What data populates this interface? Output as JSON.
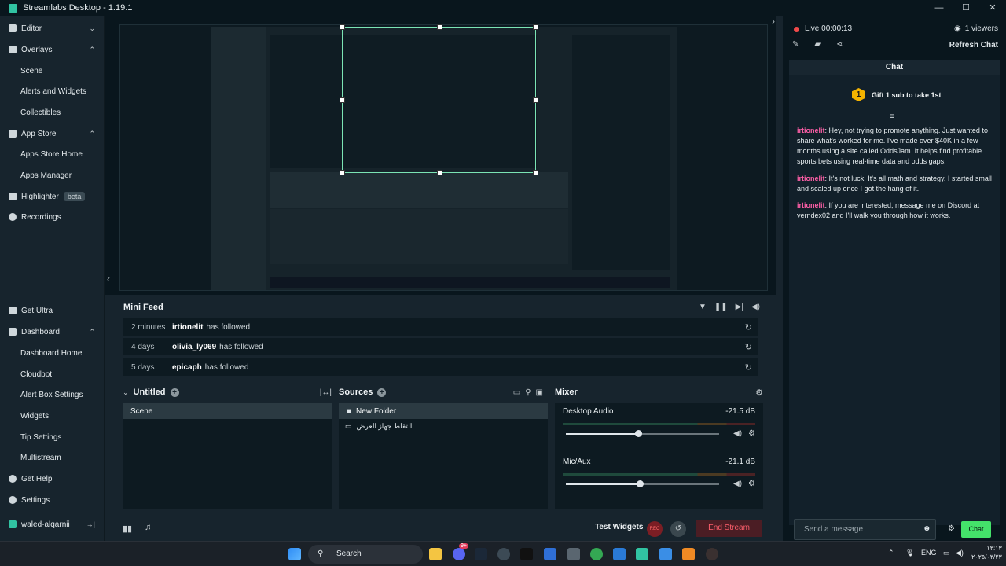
{
  "window": {
    "title": "Streamlabs Desktop - 1.19.1",
    "controls": [
      "—",
      "☐",
      "✕"
    ]
  },
  "sidebar": {
    "top_items": [
      {
        "label": "Editor",
        "icon": "editor-icon",
        "chevron": "⌄"
      },
      {
        "label": "Overlays",
        "icon": "overlays-icon",
        "chevron": "⌃"
      },
      {
        "label": "Scene",
        "sub": true
      },
      {
        "label": "Alerts and Widgets",
        "sub": true
      },
      {
        "label": "Collectibles",
        "sub": true
      },
      {
        "label": "App Store",
        "icon": "app-store-icon",
        "chevron": "⌃"
      },
      {
        "label": "Apps Store Home",
        "sub": true
      },
      {
        "label": "Apps Manager",
        "sub": true
      },
      {
        "label": "Highlighter",
        "icon": "highlighter-icon",
        "badge": "beta"
      },
      {
        "label": "Recordings",
        "icon": "recordings-icon"
      }
    ],
    "bottom_items": [
      {
        "label": "Get Ultra",
        "icon": "ultra-icon"
      },
      {
        "label": "Dashboard",
        "icon": "dashboard-icon",
        "chevron": "⌃"
      },
      {
        "label": "Dashboard Home",
        "sub": true
      },
      {
        "label": "Cloudbot",
        "sub": true
      },
      {
        "label": "Alert Box Settings",
        "sub": true
      },
      {
        "label": "Widgets",
        "sub": true
      },
      {
        "label": "Tip Settings",
        "sub": true
      },
      {
        "label": "Multistream",
        "sub": true
      },
      {
        "label": "Get Help",
        "icon": "help-icon"
      },
      {
        "label": "Settings",
        "icon": "settings-icon"
      }
    ],
    "user": {
      "name": "waled-alqarnii",
      "logout_icon": "→|"
    }
  },
  "mini_feed": {
    "title": "Mini Feed",
    "rows": [
      {
        "time": "2 minutes",
        "user": "irtionelit",
        "action": "has followed"
      },
      {
        "time": "4 days",
        "user": "olivia_ly069",
        "action": "has followed"
      },
      {
        "time": "5 days",
        "user": "epicaph",
        "action": "has followed"
      }
    ]
  },
  "scenes": {
    "title": "Untitled",
    "items": [
      "Scene"
    ]
  },
  "sources": {
    "title": "Sources",
    "folder": "New Folder",
    "items": [
      "التقاط جهاز العرض"
    ]
  },
  "mixer": {
    "title": "Mixer",
    "channels": [
      {
        "name": "Desktop Audio",
        "db": "-21.5 dB",
        "level": 0.47
      },
      {
        "name": "Mic/Aux",
        "db": "-21.1 dB",
        "level": 0.48
      }
    ]
  },
  "footer": {
    "test_widgets": "Test Widgets",
    "rec": "REC",
    "end_stream": "End Stream"
  },
  "stream": {
    "live_label": "Live",
    "time": "00:00:13",
    "viewers": "1 viewers",
    "refresh_chat": "Refresh Chat"
  },
  "chat": {
    "title": "Chat",
    "gift_number": "1",
    "gift_text": "Gift 1 sub to take 1st",
    "messages": [
      {
        "user": "irtionelit",
        "text": ": Hey, not trying to promote anything. Just wanted to share what's worked for me. I've made over $40K in a few months using a site called OddsJam. It helps find profitable sports bets using real-time data and odds gaps."
      },
      {
        "user": "irtionelit",
        "text": ": It's not luck. It's all math and strategy. I started small and scaled up once I got the hang of it."
      },
      {
        "user": "irtionelit",
        "text": ": If you are interested, message me on Discord at verndex02 and I'll walk you through how it works."
      }
    ],
    "placeholder": "Send a message",
    "send_label": "Chat"
  },
  "taskbar": {
    "search": "Search",
    "notification_count": "9+",
    "lang": "ENG",
    "time": "١٣:١٣",
    "date": "٢٠٢٥/٠٣/٢٣"
  },
  "colors": {
    "accent": "#31c3a2",
    "live": "#f04a4a",
    "chat_user": "#ff5fa8",
    "send_button": "#44e26a",
    "end_stream": "#ff5f6c"
  }
}
